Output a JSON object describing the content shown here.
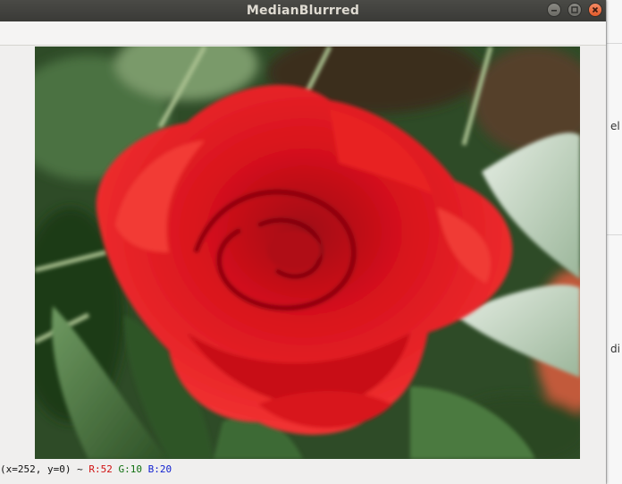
{
  "window": {
    "title": "MedianBlurrred",
    "controls": [
      {
        "name": "minimize",
        "icon": "minimize-icon"
      },
      {
        "name": "maximize",
        "icon": "maximize-icon"
      },
      {
        "name": "close",
        "icon": "close-icon"
      }
    ]
  },
  "status": {
    "coords": "(x=252, y=0) ~",
    "r": "R:52",
    "g": "G:10",
    "b": "B:20"
  },
  "background_window": {
    "fragments": [
      "el",
      "di"
    ]
  },
  "colors": {
    "titlebar": "#3c3b37",
    "rose_red": "#e0141e",
    "leaf_green": "#3a6a30"
  }
}
